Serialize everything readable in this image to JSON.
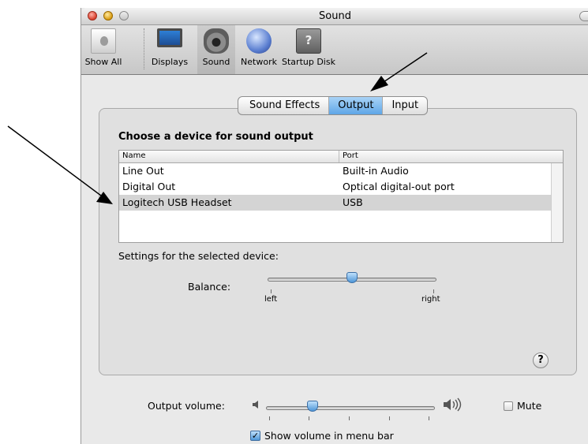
{
  "window": {
    "title": "Sound"
  },
  "toolbar": {
    "items": [
      {
        "label": "Show All",
        "icon": "apple-logo-icon"
      },
      {
        "label": "Displays",
        "icon": "display-icon"
      },
      {
        "label": "Sound",
        "icon": "speaker-icon",
        "selected": true
      },
      {
        "label": "Network",
        "icon": "globe-icon"
      },
      {
        "label": "Startup Disk",
        "icon": "hard-disk-icon"
      }
    ]
  },
  "tabs": [
    {
      "label": "Sound Effects",
      "selected": false
    },
    {
      "label": "Output",
      "selected": true
    },
    {
      "label": "Input",
      "selected": false
    }
  ],
  "output": {
    "heading": "Choose a device for sound output",
    "columns": [
      "Name",
      "Port"
    ],
    "rows": [
      {
        "name": "Line Out",
        "port": "Built-in Audio"
      },
      {
        "name": "Digital Out",
        "port": "Optical digital-out port"
      },
      {
        "name": "Logitech USB Headset",
        "port": "USB",
        "selected": true
      }
    ],
    "settings_label": "Settings for the selected device:",
    "balance": {
      "label": "Balance:",
      "left_label": "left",
      "right_label": "right",
      "value": 0.5
    }
  },
  "help": {
    "label": "?"
  },
  "volume": {
    "label": "Output volume:",
    "value": 0.27,
    "mute_label": "Mute",
    "mute_checked": false,
    "show_in_menu_label": "Show volume in menu bar",
    "show_in_menu_checked": true
  },
  "colors": {
    "selection_blue": "#5ea6e7",
    "selected_row": "#d4d4d4"
  }
}
